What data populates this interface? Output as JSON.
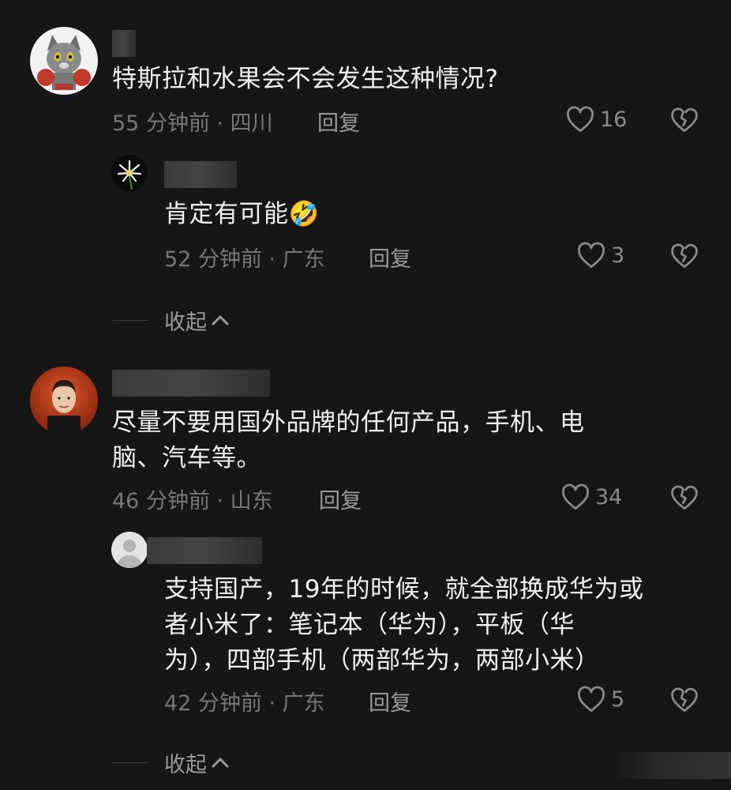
{
  "comments": [
    {
      "text": "特斯拉和水果会不会发生这种情况?",
      "meta": "55 分钟前 · 四川",
      "reply": "回复",
      "likes": "16",
      "replies": [
        {
          "text": "肯定有可能🤣",
          "meta": "52 分钟前 · 广东",
          "reply": "回复",
          "likes": "3"
        }
      ],
      "collapse": "收起"
    },
    {
      "text": "尽量不要用国外品牌的任何产品，手机、电\n脑、汽车等。",
      "meta": "46 分钟前 · 山东",
      "reply": "回复",
      "likes": "34",
      "replies": [
        {
          "text": "支持国产，19年的时候，就全部换成华为或\n者小米了：笔记本（华为），平板（华\n为），四部手机（两部华为，两部小米）",
          "meta": "42 分钟前 · 广东",
          "reply": "回复",
          "likes": "5"
        }
      ],
      "collapse": "收起"
    }
  ],
  "icons": {
    "like": "heart-outline-icon",
    "dislike": "broken-heart-icon",
    "collapse": "chevron-up-icon"
  },
  "colors": {
    "background": "#161616",
    "text": "#f0f0f0",
    "meta": "#777777"
  }
}
